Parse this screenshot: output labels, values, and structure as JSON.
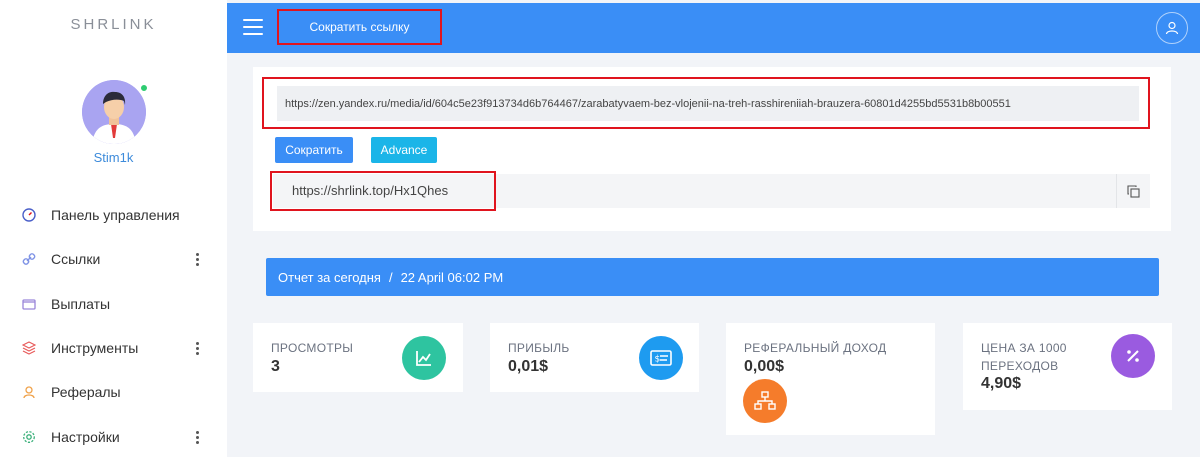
{
  "sidebar": {
    "brand": "SHRLINK",
    "username": "Stim1k",
    "items": [
      {
        "label": "Панель управления",
        "icon": "dashboard-icon",
        "has_more": false
      },
      {
        "label": "Ссылки",
        "icon": "link-icon",
        "has_more": true
      },
      {
        "label": "Выплаты",
        "icon": "wallet-icon",
        "has_more": false
      },
      {
        "label": "Инструменты",
        "icon": "layers-icon",
        "has_more": true
      },
      {
        "label": "Рефералы",
        "icon": "referrals-icon",
        "has_more": false
      },
      {
        "label": "Настройки",
        "icon": "gear-icon",
        "has_more": true
      }
    ]
  },
  "topbar": {
    "action_label": "Сократить ссылку"
  },
  "shorten": {
    "url_value": "https://zen.yandex.ru/media/id/604c5e23f913734d6b764467/zarabatyvaem-bez-vlojenii-na-treh-rasshireniiah-brauzera-60801d4255bd5531b8b00551",
    "shorten_label": "Сократить",
    "advance_label": "Advance",
    "short_url": "https://shrlink.top/Hx1Qhes"
  },
  "report": {
    "title": "Отчет за сегодня",
    "separator": "/",
    "date": "22 April 06:02 PM"
  },
  "stats": [
    {
      "title": "ПРОСМОТРЫ",
      "value": "3",
      "icon": "chart-icon",
      "color": "#2ec4a0"
    },
    {
      "title": "ПРИБЫЛЬ",
      "value": "0,01$",
      "icon": "money-icon",
      "color": "#1e9bf0"
    },
    {
      "title": "РЕФЕРАЛЬНЫЙ ДОХОД",
      "value": "0,00$",
      "icon": "network-icon",
      "color": "#f57c2b"
    },
    {
      "title": "ЦЕНА ЗА 1000 ПЕРЕХОДОВ",
      "value": "4,90$",
      "icon": "percent-icon",
      "color": "#9a5be0"
    }
  ],
  "colors": {
    "primary": "#3a8ef6",
    "accent_cyan": "#1bb5e8",
    "highlight_red": "#e0141e",
    "online": "#2ecc71"
  }
}
